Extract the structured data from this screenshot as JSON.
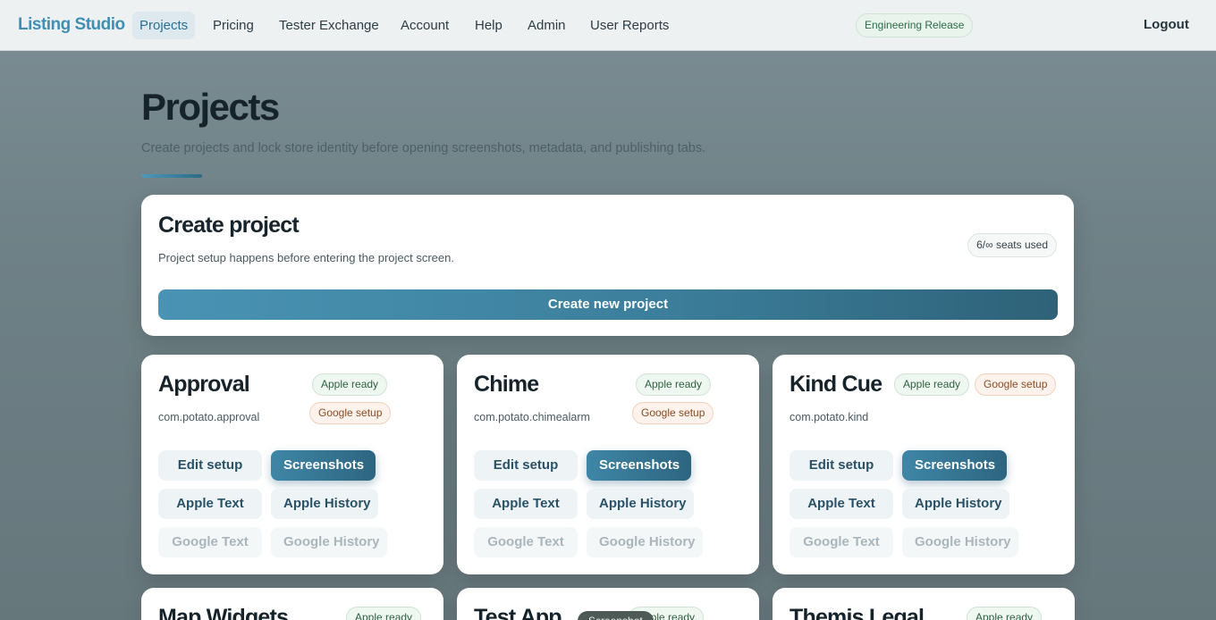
{
  "app": {
    "brand": "Listing Studio"
  },
  "nav": {
    "items": [
      {
        "label": "Projects",
        "active": true
      },
      {
        "label": "Pricing"
      },
      {
        "label": "Tester Exchange"
      },
      {
        "label": "Account"
      },
      {
        "label": "Help"
      },
      {
        "label": "Admin"
      },
      {
        "label": "User Reports"
      }
    ],
    "release_badge": "Engineering Release",
    "logout": "Logout"
  },
  "header": {
    "title": "Projects",
    "subtitle": "Create projects and lock store identity before opening screenshots, metadata, and publishing tabs."
  },
  "create": {
    "title": "Create project",
    "description": "Project setup happens before entering the project screen.",
    "seats": "6/∞ seats used",
    "button": "Create new project"
  },
  "projects": [
    {
      "name": "Approval",
      "bundle": "com.potato.approval",
      "apple": "Apple ready",
      "google": "Google setup",
      "edit": "Edit setup",
      "screenshots": "Screenshots",
      "apple_text": "Apple Text",
      "apple_history": "Apple History",
      "google_text": "Google Text",
      "google_history": "Google History"
    },
    {
      "name": "Chime",
      "bundle": "com.potato.chimealarm",
      "apple": "Apple ready",
      "google": "Google setup",
      "edit": "Edit setup",
      "screenshots": "Screenshots",
      "apple_text": "Apple Text",
      "apple_history": "Apple History",
      "google_text": "Google Text",
      "google_history": "Google History"
    },
    {
      "name": "Kind Cue",
      "bundle": "com.potato.kind",
      "apple": "Apple ready",
      "google": "Google setup",
      "edit": "Edit setup",
      "screenshots": "Screenshots",
      "apple_text": "Apple Text",
      "apple_history": "Apple History",
      "google_text": "Google Text",
      "google_history": "Google History"
    },
    {
      "name": "Map Widgets",
      "apple": "Apple ready"
    },
    {
      "name": "Test App",
      "apple": "Apple ready"
    },
    {
      "name": "Themis Legal",
      "apple": "Apple ready"
    }
  ],
  "toast": "Screenshot",
  "colors": {
    "accent": "#3f8fb5",
    "primary_button": "#2d6580",
    "apple_badge": "#eef7f0",
    "google_badge": "#fdf3ec"
  }
}
